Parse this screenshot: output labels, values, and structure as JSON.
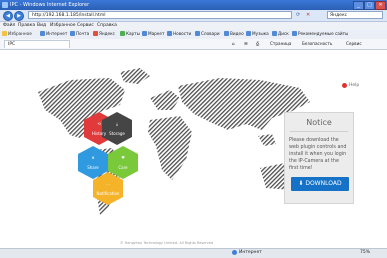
{
  "window": {
    "title": "IPC - Windows Internet Explorer",
    "minimize": "_",
    "maximize": "□",
    "close": "✕"
  },
  "address": {
    "back": "◀",
    "forward": "▶",
    "url": "http://192.168.1.185/Install.html",
    "search_placeholder": "Яндекс"
  },
  "menu": [
    "Файл",
    "Правка",
    "Вид",
    "Избранное",
    "Сервис",
    "Справка"
  ],
  "favorites": {
    "label": "Избранное",
    "items": [
      "Интернет",
      "Почта",
      "Яндекс",
      "Карты",
      "Маркет",
      "Новости",
      "Словари",
      "Видео",
      "Музыка",
      "Диск",
      "Рекомендуемые сайты"
    ]
  },
  "tab": {
    "title": "IPC"
  },
  "commands": [
    "Страница",
    "Безопасность",
    "Сервис"
  ],
  "page": {
    "help": "Help",
    "notice_title": "Notice",
    "notice_message": "Please download the web plugin controls and install it when you login the IP-Camera at the first time!",
    "download_label": "DOWNLOAD",
    "copyright": "© Hangzhou Technology Limited. All Rights Reserved",
    "hexagons": [
      "History",
      "Storage",
      "Share",
      "Care",
      "Notification"
    ],
    "colors": {
      "red": "#e03a3a",
      "dark": "#454545",
      "blue": "#2f9ae0",
      "green": "#79c93a",
      "yellow": "#f5b32a",
      "download": "#1572c6"
    }
  },
  "status": {
    "zone": "Интернет",
    "zoom": "75%"
  }
}
